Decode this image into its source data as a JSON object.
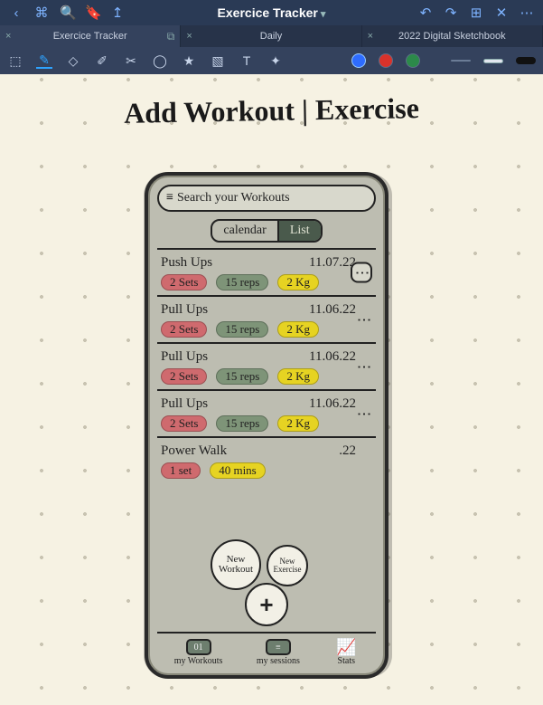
{
  "menubar": {
    "title": "Exercice Tracker",
    "left_icons": [
      "‹",
      "⌘",
      "🔍",
      "🔖",
      "↥"
    ],
    "right_icons": [
      "↶",
      "↷",
      "⊞",
      "✕",
      "⋯"
    ]
  },
  "tabs": [
    {
      "label": "Exercice Tracker",
      "active": true,
      "closable": true,
      "addable": true
    },
    {
      "label": "Daily",
      "active": false,
      "closable": true,
      "addable": false
    },
    {
      "label": "2022 Digital Sketchbook",
      "active": false,
      "closable": true,
      "addable": false
    }
  ],
  "tools": {
    "left": [
      "⬚",
      "✎",
      "◇",
      "✐",
      "✂",
      "◯",
      "★",
      "▧",
      "T",
      "✦"
    ],
    "colors": [
      "blue",
      "red",
      "green"
    ],
    "strokes": [
      "thin",
      "mid",
      "thick"
    ],
    "selected_index": 1
  },
  "canvas": {
    "title_handwritten": "Add Workout | Exercise"
  },
  "phone": {
    "search_placeholder": "Search your Workouts",
    "toggle": {
      "left": "calendar",
      "right": "List",
      "selected": "right"
    },
    "rows": [
      {
        "name": "Push Ups",
        "date": "11.07.22",
        "sets": "2 Sets",
        "reps": "15 reps",
        "weight": "2 Kg",
        "kebab_boxed": true
      },
      {
        "name": "Pull Ups",
        "date": "11.06.22",
        "sets": "2 Sets",
        "reps": "15 reps",
        "weight": "2 Kg",
        "kebab_boxed": false
      },
      {
        "name": "Pull Ups",
        "date": "11.06.22",
        "sets": "2 Sets",
        "reps": "15 reps",
        "weight": "2 Kg",
        "kebab_boxed": false
      },
      {
        "name": "Pull Ups",
        "date": "11.06.22",
        "sets": "2 Sets",
        "reps": "15 reps",
        "weight": "2 Kg",
        "kebab_boxed": false
      },
      {
        "name": "Power Walk",
        "date": ".22",
        "sets": "1 set",
        "reps": "",
        "weight": "40 mins",
        "kebab_boxed": false
      }
    ],
    "fab": {
      "main": "+",
      "left": "New Workout",
      "right": "New Exercise"
    },
    "nav": [
      {
        "icon_label": "01",
        "label": "my Workouts"
      },
      {
        "icon_label": "≡",
        "label": "my sessions"
      },
      {
        "icon_label": "📈",
        "label": "Stats"
      }
    ]
  }
}
